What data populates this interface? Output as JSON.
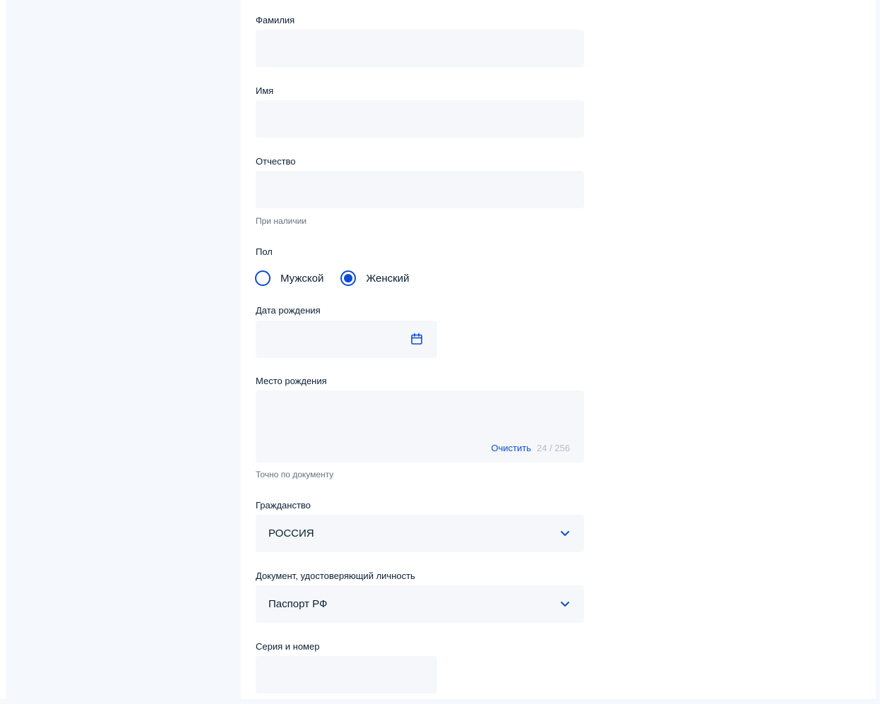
{
  "form": {
    "last_name": {
      "label": "Фамилия",
      "value": ""
    },
    "first_name": {
      "label": "Имя",
      "value": ""
    },
    "patronymic": {
      "label": "Отчество",
      "value": "",
      "hint": "При наличии"
    },
    "gender": {
      "label": "Пол",
      "options": [
        "Мужской",
        "Женский"
      ],
      "selected": "Женский"
    },
    "birth_date": {
      "label": "Дата рождения",
      "value": "",
      "icon": "calendar-icon"
    },
    "birth_place": {
      "label": "Место рождения",
      "value": "",
      "clear_label": "Очистить",
      "counter": "24 / 256",
      "hint": "Точно по документу"
    },
    "citizenship": {
      "label": "Гражданство",
      "value": "РОССИЯ",
      "icon": "chevron-down-icon"
    },
    "id_document": {
      "label": "Документ, удостоверяющий личность",
      "value": "Паспорт РФ",
      "icon": "chevron-down-icon"
    },
    "series_number": {
      "label": "Серия и номер",
      "value": ""
    }
  },
  "colors": {
    "accent": "#0d4cd3",
    "field_bg": "#f5f7fa",
    "panel_bg": "#f5f8fc",
    "text": "#0b1f33",
    "hint": "#66727f",
    "counter": "#b3bdc8"
  }
}
